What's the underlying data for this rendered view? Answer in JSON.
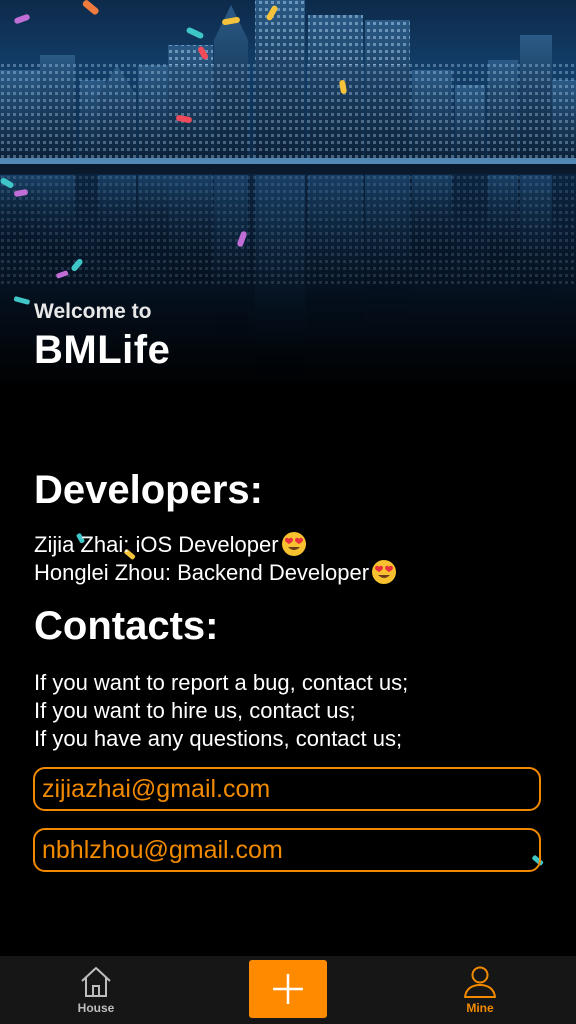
{
  "hero": {
    "welcome_text": "Welcome to",
    "app_name": "BMLife"
  },
  "developers": {
    "title": "Developers:",
    "items": [
      {
        "text": "Zijia Zhai: iOS Developer",
        "emoji": "heart-eyes-emoji"
      },
      {
        "text": "Honglei Zhou: Backend Developer",
        "emoji": "heart-eyes-emoji"
      }
    ]
  },
  "contacts": {
    "title": "Contacts:",
    "lines": [
      "If you want to report a bug, contact us;",
      "If you want to hire us, contact us;",
      "If you have any questions, contact us;"
    ],
    "emails": [
      "zijiazhai@gmail.com",
      "nbhlzhou@gmail.com"
    ]
  },
  "tabbar": {
    "house_label": "House",
    "mine_label": "Mine",
    "house_icon": "house-icon",
    "add_icon": "plus-icon",
    "mine_icon": "person-icon"
  },
  "colors": {
    "accent": "#f28a00",
    "add_button": "#ff8a00",
    "tabbar_bg": "#161616",
    "inactive_tab": "#bdbdbd"
  }
}
